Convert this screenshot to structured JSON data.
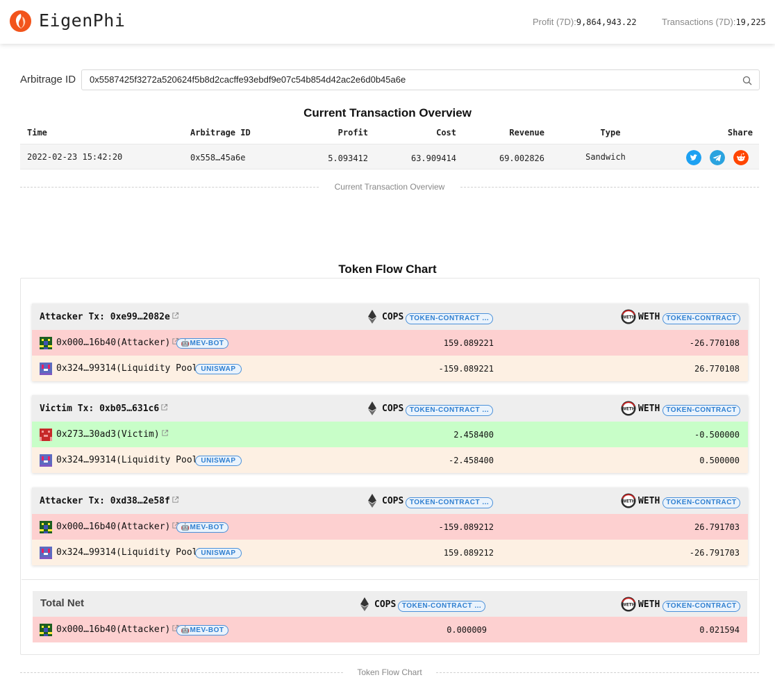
{
  "header": {
    "brand": "EigenPhi",
    "profit_label": "Profit (7D):",
    "profit_value": "9,864,943.22",
    "tx_label": "Transactions (7D):",
    "tx_value": "19,225"
  },
  "search": {
    "label": "Arbitrage ID",
    "value": "0x5587425f3272a520624f5b8d2cacffe93ebdf9e07c54b854d42ac2e6d0b45a6e"
  },
  "overview": {
    "title": "Current Transaction Overview",
    "columns": [
      "Time",
      "Arbitrage ID",
      "Profit",
      "Cost",
      "Revenue",
      "Type",
      "Share"
    ],
    "row": {
      "time": "2022-02-23 15:42:20",
      "id": "0x558…45a6e",
      "profit": "5.093412",
      "cost": "63.909414",
      "revenue": "69.002826",
      "type": "Sandwich"
    },
    "divider": "Current Transaction Overview"
  },
  "flow": {
    "title": "Token Flow Chart",
    "token_a": {
      "symbol": "COPS",
      "tag": "TOKEN-CONTRACT ..."
    },
    "token_b": {
      "symbol": "WETH",
      "tag": "TOKEN-CONTRACT"
    },
    "cards": [
      {
        "label": "Attacker Tx: 0xe99…2082e",
        "rows": [
          {
            "addr": "0x000…16b40(Attacker)",
            "tag": "MEV-BOT",
            "a": "159.089221",
            "b": "-26.770108"
          },
          {
            "addr": "0x324…99314(Liquidity Pool)",
            "tag": "UNISWAP",
            "a": "-159.089221",
            "b": "26.770108"
          }
        ]
      },
      {
        "label": "Victim Tx: 0xb05…631c6",
        "rows": [
          {
            "addr": "0x273…30ad3(Victim)",
            "tag": "",
            "a": "2.458400",
            "b": "-0.500000"
          },
          {
            "addr": "0x324…99314(Liquidity Pool)",
            "tag": "UNISWAP",
            "a": "-2.458400",
            "b": "0.500000"
          }
        ]
      },
      {
        "label": "Attacker Tx: 0xd38…2e58f",
        "rows": [
          {
            "addr": "0x000…16b40(Attacker)",
            "tag": "MEV-BOT",
            "a": "-159.089212",
            "b": "26.791703"
          },
          {
            "addr": "0x324…99314(Liquidity Pool)",
            "tag": "UNISWAP",
            "a": "159.089212",
            "b": "-26.791703"
          }
        ]
      }
    ],
    "total": {
      "label": "Total Net",
      "addr": "0x000…16b40(Attacker)",
      "tag": "MEV-BOT",
      "a": "0.000009",
      "b": "0.021594"
    },
    "divider": "Token Flow Chart"
  },
  "colors": {
    "attacker_row": "#fdd0d0",
    "pool_row": "#fdf0e3",
    "victim_row": "#c8fec8",
    "tag_blue": "#2f7fd0",
    "twitter": "#1da1f2",
    "telegram": "#2aa3df",
    "reddit": "#ff4500"
  }
}
